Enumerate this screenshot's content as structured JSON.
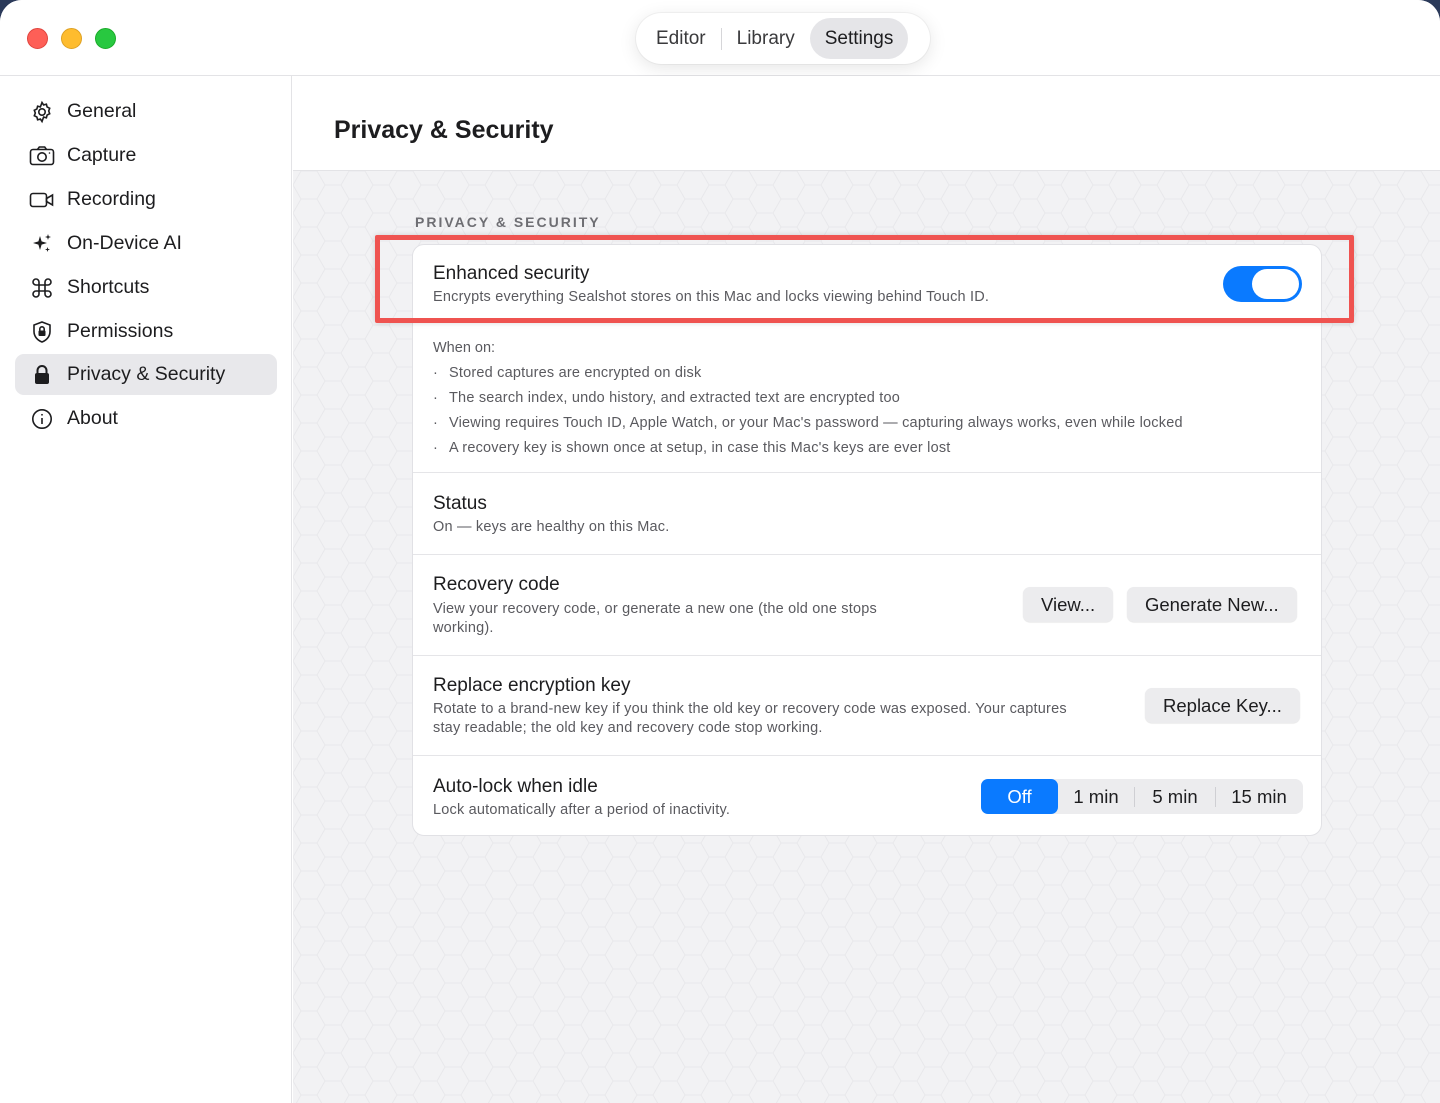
{
  "nav": {
    "tabs": [
      {
        "label": "Editor"
      },
      {
        "label": "Library"
      },
      {
        "label": "Settings"
      }
    ],
    "active_tab": "Settings"
  },
  "sidebar": {
    "items": [
      {
        "label": "General",
        "icon": "gear-icon"
      },
      {
        "label": "Capture",
        "icon": "camera-icon"
      },
      {
        "label": "Recording",
        "icon": "video-icon"
      },
      {
        "label": "On-Device AI",
        "icon": "sparkles-icon"
      },
      {
        "label": "Shortcuts",
        "icon": "command-icon"
      },
      {
        "label": "Permissions",
        "icon": "lock-shield-icon"
      },
      {
        "label": "Privacy & Security",
        "icon": "lock-icon"
      },
      {
        "label": "About",
        "icon": "info-icon"
      }
    ],
    "selected": "Privacy & Security"
  },
  "page": {
    "title": "Privacy & Security",
    "section_label": "PRIVACY & SECURITY"
  },
  "enhanced": {
    "title": "Enhanced security",
    "description": "Encrypts everything Sealshot stores on this Mac and locks viewing behind Touch ID.",
    "enabled": true,
    "when_on_label": "When on:",
    "bullets": [
      "Stored captures are encrypted on disk",
      "The search index, undo history, and extracted text are encrypted too",
      "Viewing requires Touch ID, Apple Watch, or your Mac's password — capturing always works, even while locked",
      "A recovery key is shown once at setup, in case this Mac's keys are ever lost"
    ]
  },
  "status": {
    "title": "Status",
    "description": "On — keys are healthy on this Mac."
  },
  "recovery": {
    "title": "Recovery code",
    "description": "View your recovery code, or generate a new one (the old one stops working).",
    "view_label": "View...",
    "generate_label": "Generate New..."
  },
  "replace": {
    "title": "Replace encryption key",
    "description": "Rotate to a brand-new key if you think the old key or recovery code was exposed. Your captures stay readable; the old key and recovery code stop working.",
    "button_label": "Replace Key..."
  },
  "autolock": {
    "title": "Auto-lock when idle",
    "description": "Lock automatically after a period of inactivity.",
    "options": [
      "Off",
      "1 min",
      "5 min",
      "15 min"
    ],
    "selected": "Off"
  },
  "colors": {
    "accent": "#0a7aff",
    "highlight": "#ef5350",
    "traffic_red": "#fe5f57",
    "traffic_yellow": "#febc2e",
    "traffic_green": "#28c840"
  }
}
